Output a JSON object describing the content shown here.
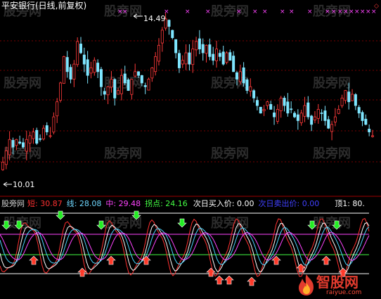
{
  "upper_panel": {
    "title": "平安银行(日线,前复权)",
    "high_label": "14.49",
    "low_label": "10.01",
    "watermark": "股旁网"
  },
  "lower_panel": {
    "legend": [
      {
        "key": "watermark",
        "text": "股旁网",
        "color": "#cccccc"
      },
      {
        "key": "short",
        "text": "短: 30.87",
        "color": "#ff3030"
      },
      {
        "key": "line",
        "text": "线: 28.08",
        "color": "#6fd8ff"
      },
      {
        "key": "mid",
        "text": "中: 29.48",
        "color": "#ff44ff"
      },
      {
        "key": "turn",
        "text": "拐点: 24.16",
        "color": "#44ff44"
      },
      {
        "key": "buy",
        "text": "次日买入价: 0.00",
        "color": "#ffffff"
      },
      {
        "key": "sell",
        "text": "次日卖出价: 0.00",
        "color": "#4040ff"
      },
      {
        "key": "top",
        "text": "顶1: 80.",
        "color": "#ffffff"
      }
    ]
  },
  "logo": {
    "brand": "智股网",
    "url": "raiyue.com"
  },
  "colors": {
    "up": "#ff3a3a",
    "down": "#7fe6ff",
    "grid": "#7a0000",
    "magenta": "#ff44ff",
    "green": "#44ff44",
    "white": "#ffffff"
  },
  "chart_data": [
    {
      "type": "candlestick",
      "title": "平安银行(日线,前复权)",
      "annotations": [
        "14.49",
        "10.01"
      ],
      "ylim": [
        10.01,
        14.49
      ],
      "series": [
        {
          "name": "close",
          "values": [
            10.6,
            10.9,
            11.2,
            11.0,
            11.2,
            11.1,
            11.0,
            11.2,
            11.3,
            11.4,
            11.1,
            11.2,
            11.5,
            11.4,
            11.3,
            11.8,
            12.2,
            12.7,
            13.4,
            13.0,
            12.8,
            13.2,
            13.8,
            13.5,
            13.2,
            12.9,
            13.1,
            13.3,
            13.0,
            12.6,
            12.4,
            12.6,
            12.8,
            12.3,
            12.5,
            12.9,
            12.7,
            12.5,
            12.8,
            13.0,
            12.9,
            12.7,
            12.6,
            12.8,
            13.1,
            13.4,
            13.7,
            14.1,
            14.4,
            14.2,
            13.9,
            13.5,
            13.1,
            13.3,
            13.5,
            13.2,
            13.6,
            13.8,
            13.6,
            13.5,
            13.7,
            13.4,
            13.3,
            13.6,
            13.4,
            13.2,
            13.5,
            13.3,
            13.0,
            12.8,
            13.0,
            12.7,
            12.5,
            12.6,
            12.3,
            12.1,
            11.9,
            12.0,
            12.2,
            12.0,
            11.8,
            12.0,
            12.3,
            12.1,
            11.9,
            12.0,
            11.8,
            11.7,
            11.9,
            12.1,
            11.8,
            11.6,
            11.8,
            12.0,
            11.9,
            11.7,
            11.5,
            11.6,
            11.8,
            12.0,
            12.3,
            12.5,
            12.2,
            12.4,
            12.1,
            11.9,
            11.7,
            11.6,
            11.4,
            11.3
          ]
        }
      ]
    },
    {
      "type": "line",
      "series": [
        {
          "name": "短",
          "values": [
            30.87
          ]
        },
        {
          "name": "线",
          "values": [
            28.08
          ]
        },
        {
          "name": "中",
          "values": [
            29.48
          ]
        },
        {
          "name": "拐点",
          "values": [
            24.16
          ]
        },
        {
          "name": "次日买入价",
          "values": [
            0.0
          ]
        },
        {
          "name": "次日卖出价",
          "values": [
            0.0
          ]
        },
        {
          "name": "顶1",
          "values": [
            80
          ]
        }
      ]
    }
  ]
}
